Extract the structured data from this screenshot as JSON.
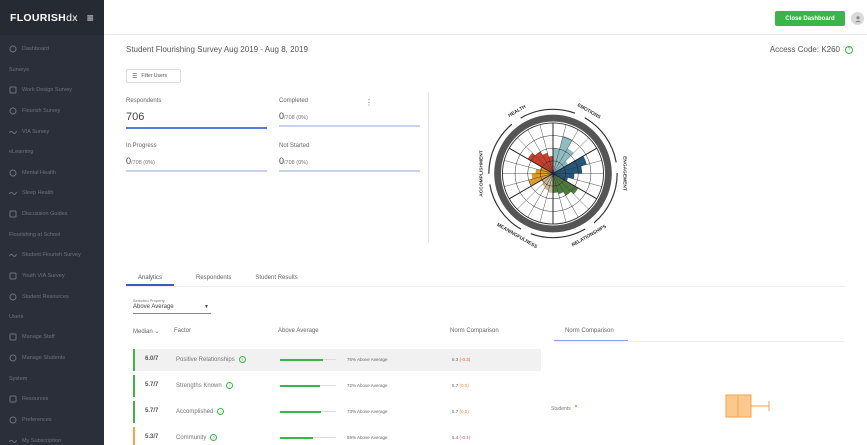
{
  "app": {
    "brand": "FLOURISH",
    "brand_suffix": "dx"
  },
  "sidebar": {
    "items": [
      {
        "type": "item",
        "label": "Dashboard",
        "icon": "dashboard-icon"
      },
      {
        "type": "section",
        "label": "Surveys"
      },
      {
        "type": "item",
        "label": "Work Design Survey",
        "icon": "work-design-icon"
      },
      {
        "type": "item",
        "label": "Flourish Survey",
        "icon": "flourish-icon"
      },
      {
        "type": "item",
        "label": "VIA Survey",
        "icon": "via-icon"
      },
      {
        "type": "section",
        "label": "eLearning"
      },
      {
        "type": "item",
        "label": "Mental Health",
        "icon": "mental-health-icon"
      },
      {
        "type": "item",
        "label": "Sleep Health",
        "icon": "sleep-health-icon"
      },
      {
        "type": "item",
        "label": "Discussion Guides",
        "icon": "discussion-guides-icon"
      },
      {
        "type": "section",
        "label": "Flourishing at School"
      },
      {
        "type": "item",
        "label": "Student Flourish Survey",
        "icon": "student-flourish-icon"
      },
      {
        "type": "item",
        "label": "Youth VIA Survey",
        "icon": "youth-via-icon"
      },
      {
        "type": "item",
        "label": "Student Resources",
        "icon": "student-resources-icon"
      },
      {
        "type": "section",
        "label": "Users"
      },
      {
        "type": "item",
        "label": "Manage Staff",
        "icon": "manage-staff-icon"
      },
      {
        "type": "item",
        "label": "Manage Students",
        "icon": "manage-students-icon"
      },
      {
        "type": "section",
        "label": "System"
      },
      {
        "type": "item",
        "label": "Resources",
        "icon": "resources-icon"
      },
      {
        "type": "item",
        "label": "Preferences",
        "icon": "preferences-icon"
      },
      {
        "type": "item",
        "label": "My Subscription",
        "icon": "subscription-icon"
      }
    ]
  },
  "topbar": {
    "close_label": "Close Dashboard"
  },
  "header": {
    "title": "Student Flourishing Survey Aug 2019 - Aug 8, 2019",
    "access_code": "Access Code: K260"
  },
  "filter": {
    "label": "Filter Users"
  },
  "stats": {
    "respondents": {
      "label": "Respondents",
      "value": "706"
    },
    "completed": {
      "label": "Completed",
      "value": "0",
      "detail": "/708 (0%)"
    },
    "in_progress": {
      "label": "In Progress",
      "value": "0",
      "detail": "/708 (0%)"
    },
    "not_started": {
      "label": "Not Started",
      "value": "0",
      "detail": "/708 (0%)"
    }
  },
  "wheel": {
    "labels": [
      "EMOTIONS",
      "ENGAGEMENT",
      "RELATIONSHIPS",
      "MEANINGFULNESS",
      "ACCOMPLISHMENT",
      "HEALTH"
    ],
    "colors": [
      "#8fbcc0",
      "#24577a",
      "#4e7a3e",
      "#c6b89a",
      "#e09a2b",
      "#c8402c"
    ]
  },
  "tabs": [
    "Analytics",
    "Respondents",
    "Student Results"
  ],
  "selector": {
    "caption": "Selected Property",
    "value": "Above Average"
  },
  "table": {
    "headers": {
      "median": "Median",
      "factor": "Factor",
      "above": "Above Average",
      "norm": "Norm Comparison"
    },
    "rows": [
      {
        "median": "6.0/7",
        "factor": "Positive Relationships",
        "above_pct": 76,
        "above_text": "76% Above Average",
        "norm_val": "6.3",
        "norm_diff": "(-0.3)",
        "diff_class": "neg",
        "accent": "green"
      },
      {
        "median": "5.7/7",
        "factor": "Strengths Known",
        "above_pct": 72,
        "above_text": "72% Above Average",
        "norm_val": "5.7",
        "norm_diff": "(0.0)",
        "diff_class": "zero",
        "accent": "green"
      },
      {
        "median": "5.7/7",
        "factor": "Accomplished",
        "above_pct": 73,
        "above_text": "73% Above Average",
        "norm_val": "5.7",
        "norm_diff": "(0.0)",
        "diff_class": "zero",
        "accent": "green"
      },
      {
        "median": "5.3/7",
        "factor": "Community",
        "above_pct": 59,
        "above_text": "59% Above Average",
        "norm_val": "5.4",
        "norm_diff": "(-0.1)",
        "diff_class": "neg",
        "accent": "orange"
      }
    ]
  },
  "norm_panel": {
    "tab": "Norm Comparison",
    "row_label": "Students"
  },
  "colors": {
    "accent_green": "#3bb54a",
    "sidebar_bg": "#2b2f3a",
    "tab_blue": "#3a5cc0",
    "orange": "#f0a54a"
  }
}
